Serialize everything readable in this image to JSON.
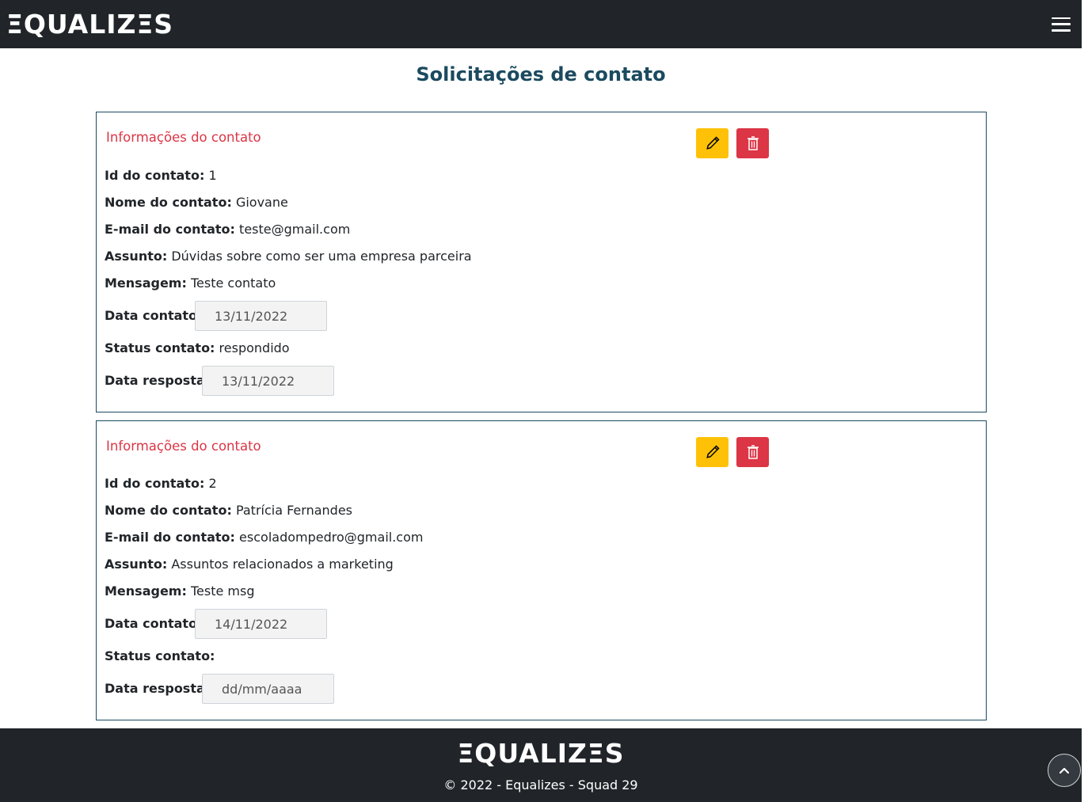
{
  "header": {
    "logo": "ΞQUALIZΞS",
    "menu_icon": "hamburger-icon"
  },
  "page": {
    "title": "Solicitações de contato"
  },
  "labels": {
    "card_title": "Informações do contato",
    "id": "Id do contato:",
    "name": "Nome do contato:",
    "email": "E-mail do contato:",
    "subject": "Assunto:",
    "message": "Mensagem:",
    "contact_date": "Data contato:",
    "status": "Status contato:",
    "response_date": "Data resposta:"
  },
  "contacts": [
    {
      "id": "1",
      "name": "Giovane",
      "email": "teste@gmail.com",
      "subject": "Dúvidas sobre como ser uma empresa parceira",
      "message": "Teste contato",
      "contact_date": "13/11/2022",
      "status": "respondido",
      "response_date": "13/11/2022"
    },
    {
      "id": "2",
      "name": "Patrícia Fernandes",
      "email": "escoladompedro@gmail.com",
      "subject": "Assuntos relacionados a marketing",
      "message": "Teste msg",
      "contact_date": "14/11/2022",
      "status": "",
      "response_date": "dd/mm/aaaa"
    }
  ],
  "footer": {
    "logo": "ΞQUALIZΞS",
    "copyright": "© 2022 - Equalizes - Squad 29"
  },
  "colors": {
    "dark": "#212529",
    "title": "#1b4a5f",
    "danger": "#dc3545",
    "warning": "#ffc107"
  }
}
